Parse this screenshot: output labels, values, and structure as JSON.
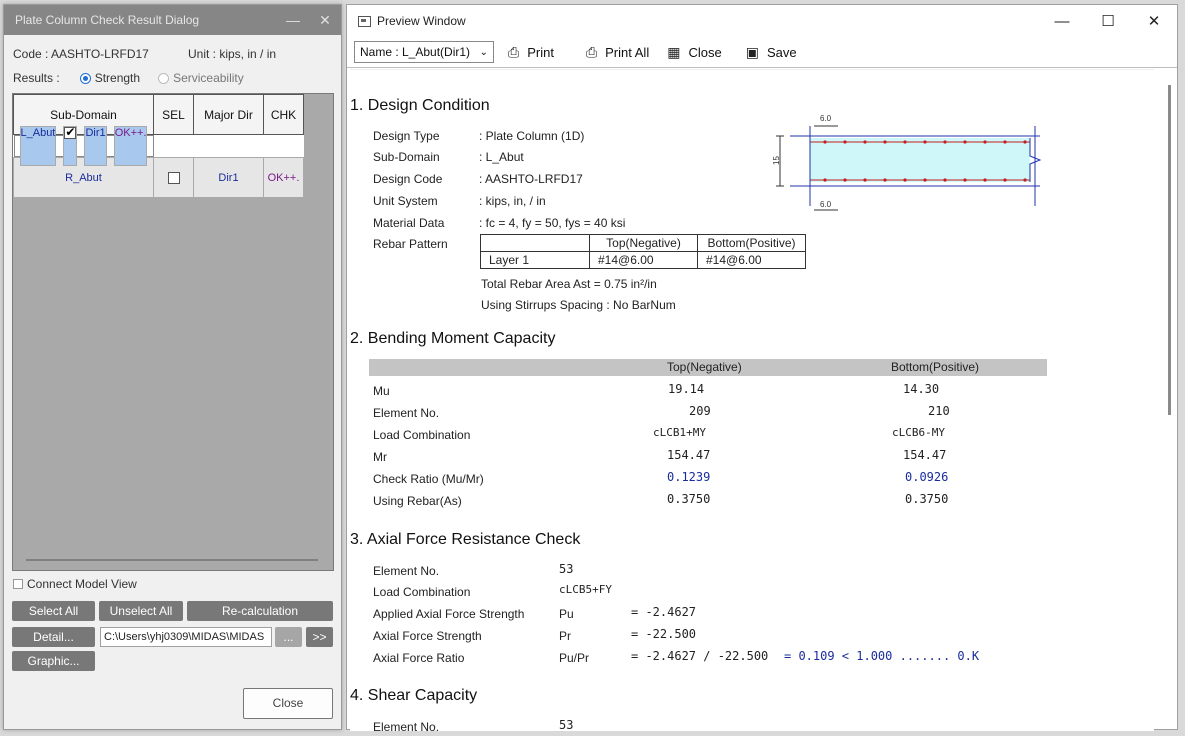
{
  "dialog": {
    "title": "Plate Column Check Result Dialog",
    "minimize": "—",
    "close_x": "✕",
    "code": "Code : AASHTO-LRFD17",
    "unit": "Unit : kips, in / in",
    "results_label": "Results :",
    "results_options": [
      "Strength",
      "Serviceability"
    ],
    "columns": [
      "Sub-Domain",
      "SEL",
      "Major Dir",
      "CHK"
    ],
    "rows": [
      {
        "sub": "L_Abut",
        "dir": "Dir1",
        "chk": "OK++."
      },
      {
        "sub": "R_Abut",
        "dir": "Dir1",
        "chk": "OK++."
      }
    ],
    "connect_model_view": "Connect Model View",
    "select_all": "Select All",
    "unselect_all": "Unselect All",
    "recalc": "Re-calculation",
    "detail": "Detail...",
    "path": "C:\\Users\\yhj0309\\MIDAS\\MIDAS",
    "browse": "...",
    "next": ">>",
    "graphic": "Graphic...",
    "close": "Close"
  },
  "preview": {
    "title": "Preview Window",
    "win_min": "—",
    "win_max": "☐",
    "win_close": "✕",
    "name_select": "Name : L_Abut(Dir1)",
    "print": "Print",
    "print_all": "Print All",
    "close": "Close",
    "save": "Save"
  },
  "report": {
    "s1": "1. Design Condition",
    "design_type_l": "Design Type",
    "design_type_v": ":  Plate Column (1D)",
    "subdomain_l": "Sub-Domain",
    "subdomain_v": ":  L_Abut",
    "code_l": "Design Code",
    "code_v": ":  AASHTO-LRFD17",
    "unit_l": "Unit System",
    "unit_v": ":  kips, in, / in",
    "mat_l": "Material Data",
    "mat_v": ":  fc = 4,   fy = 50,   fys = 40 ksi",
    "rebar_l": "Rebar Pattern",
    "rebar_head_top": "Top(Negative)",
    "rebar_head_bot": "Bottom(Positive)",
    "rebar_layer": "Layer 1",
    "rebar_top": "#14@6.00",
    "rebar_bot": "#14@6.00",
    "total_area": "Total Rebar Area   Ast = 0.75 in²/in",
    "stirrups": "Using Stirrups Spacing  :   No BarNum",
    "sketch_spacing_top": "6.0",
    "sketch_spacing_bot": "6.0",
    "sketch_depth": "15",
    "s2": "2. Bending Moment Capacity",
    "bm_head_top": "Top(Negative)",
    "bm_head_bot": "Bottom(Positive)",
    "bm_rows": [
      {
        "label": "Mu",
        "top": "19.14",
        "bot": "14.30",
        "blue": false
      },
      {
        "label": "Element No.",
        "top": "209",
        "bot": "210",
        "blue": false
      },
      {
        "label": "Load Combination",
        "top": "cLCB1+MY",
        "bot": "cLCB6-MY",
        "blue": false
      },
      {
        "label": "Mr",
        "top": "154.47",
        "bot": "154.47",
        "blue": false
      },
      {
        "label": "Check Ratio (Mu/Mr)",
        "top": "0.1239",
        "bot": "0.0926",
        "blue": true
      },
      {
        "label": "Using Rebar(As)",
        "top": "0.3750",
        "bot": "0.3750",
        "blue": false
      }
    ],
    "s3": "3. Axial Force Resistance Check",
    "ax_elem_l": "Element No.",
    "ax_elem_v": "53",
    "ax_lc_l": "Load Combination",
    "ax_lc_v": "cLCB5+FY",
    "ax_pu_l": "Applied Axial Force Strength",
    "ax_pu_s": "Pu",
    "ax_pu_v": "= -2.4627",
    "ax_pr_l": "Axial Force Strength",
    "ax_pr_s": "Pr",
    "ax_pr_v": "= -22.500",
    "ax_ratio_l": "Axial Force Ratio",
    "ax_ratio_s": "Pu/Pr",
    "ax_ratio_v": "= -2.4627 / -22.500",
    "ax_ratio_res": "= 0.109  < 1.000 ....... 0.K",
    "s4": "4. Shear Capacity",
    "sh_elem_l": "Element No.",
    "sh_elem_v": "53"
  }
}
